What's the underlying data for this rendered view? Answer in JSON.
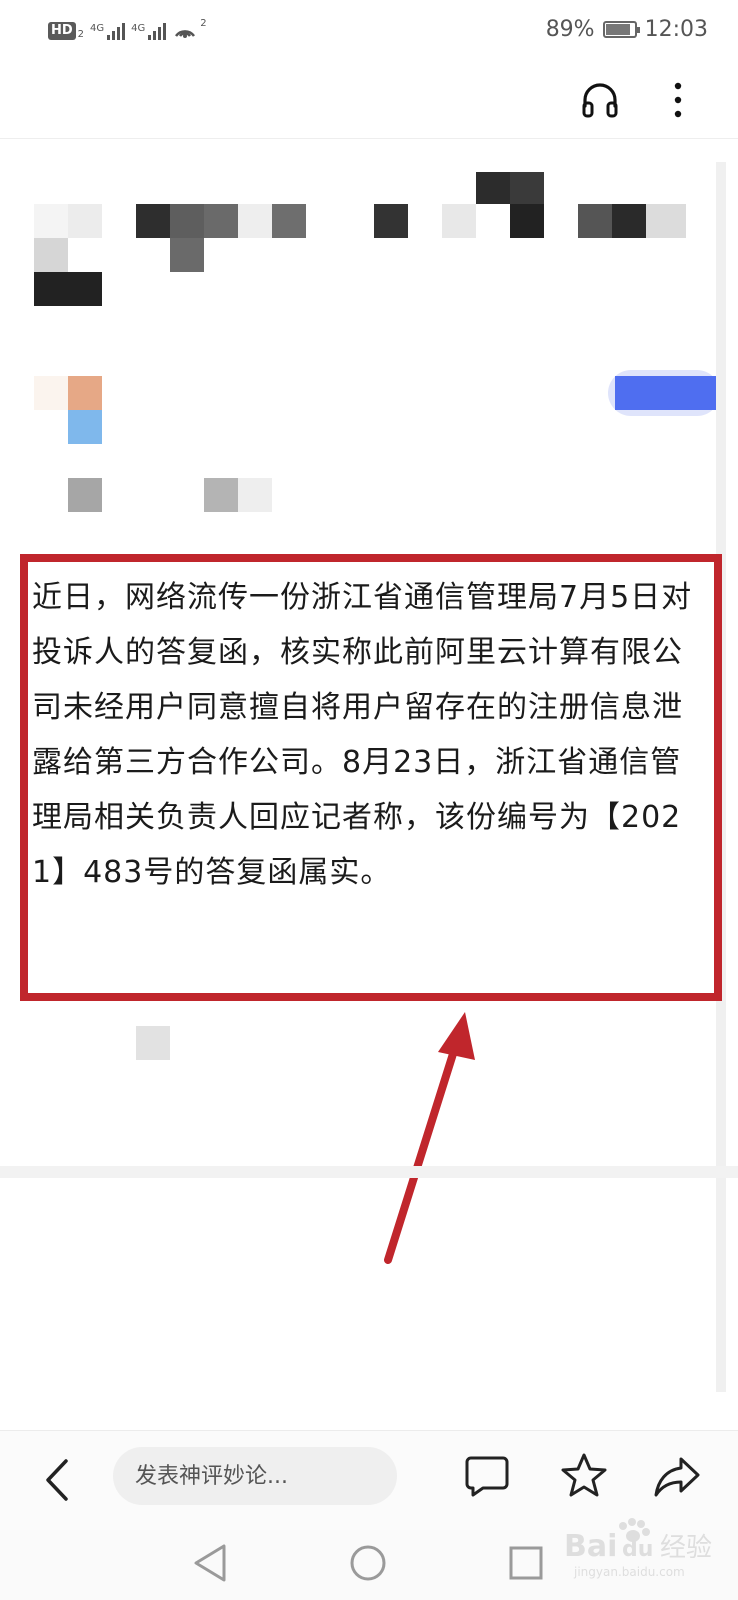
{
  "status_bar": {
    "hd_label": "HD",
    "hd_sub": "2",
    "network_1": "4G",
    "network_2": "4G",
    "wifi_sub": "2",
    "battery_percent": "89%",
    "battery_level": 0.89,
    "time": "12:03"
  },
  "article": {
    "text": "近日，网络流传一份浙江省通信管理局7月5日对投诉人的答复函，核实称此前阿里云计算有限公司未经用户同意擅自将用户留存在的注册信息泄露给第三方合作公司。8月23日，浙江省通信管理局相关负责人回应记者称，该份编号为【2021】483号的答复函属实。"
  },
  "annotation": {
    "highlight_color": "#c0262c"
  },
  "toolbar": {
    "comment_placeholder": "发表神评妙论..."
  },
  "watermark": {
    "brand": "Bai",
    "brand_suffix": "du",
    "product": "经验",
    "url": "jingyan.baidu.com"
  },
  "colors": {
    "accent_blue": "#4f6ef0",
    "annotation_red": "#c0262c"
  }
}
